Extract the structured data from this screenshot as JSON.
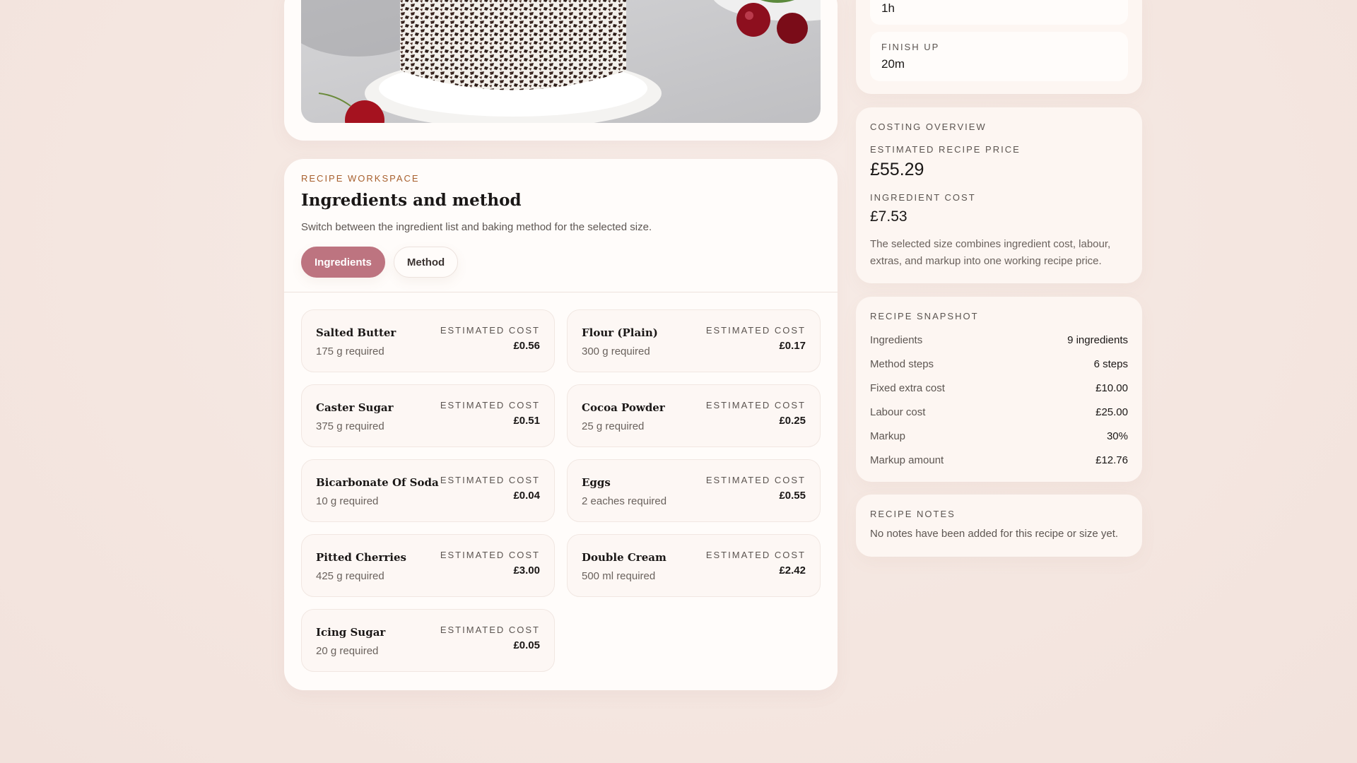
{
  "workspace": {
    "eyebrow": "RECIPE WORKSPACE",
    "title": "Ingredients and method",
    "subtitle": "Switch between the ingredient list and baking method for the selected size.",
    "tabs": [
      {
        "label": "Ingredients",
        "active": true
      },
      {
        "label": "Method",
        "active": false
      }
    ],
    "cost_label": "ESTIMATED COST",
    "ingredients": [
      {
        "name": "Salted Butter",
        "qty": "175 g required",
        "cost": "£0.56"
      },
      {
        "name": "Flour (Plain)",
        "qty": "300 g required",
        "cost": "£0.17"
      },
      {
        "name": "Caster Sugar",
        "qty": "375 g required",
        "cost": "£0.51"
      },
      {
        "name": "Cocoa Powder",
        "qty": "25 g required",
        "cost": "£0.25"
      },
      {
        "name": "Bicarbonate Of Soda",
        "qty": "10 g required",
        "cost": "£0.04"
      },
      {
        "name": "Eggs",
        "qty": "2 eaches required",
        "cost": "£0.55"
      },
      {
        "name": "Pitted Cherries",
        "qty": "425 g required",
        "cost": "£3.00"
      },
      {
        "name": "Double Cream",
        "qty": "500 ml required",
        "cost": "£2.42"
      },
      {
        "name": "Icing Sugar",
        "qty": "20 g required",
        "cost": "£0.05"
      }
    ]
  },
  "timing": {
    "top_value": "1h",
    "finish_label": "FINISH UP",
    "finish_value": "20m"
  },
  "costing": {
    "title": "COSTING OVERVIEW",
    "price_label": "ESTIMATED RECIPE PRICE",
    "price_value": "£55.29",
    "ingredient_label": "INGREDIENT COST",
    "ingredient_value": "£7.53",
    "description": "The selected size combines ingredient cost, labour, extras, and markup into one working recipe price."
  },
  "snapshot": {
    "title": "RECIPE SNAPSHOT",
    "rows": [
      {
        "k": "Ingredients",
        "v": "9 ingredients"
      },
      {
        "k": "Method steps",
        "v": "6 steps"
      },
      {
        "k": "Fixed extra cost",
        "v": "£10.00"
      },
      {
        "k": "Labour cost",
        "v": "£25.00"
      },
      {
        "k": "Markup",
        "v": "30%"
      },
      {
        "k": "Markup amount",
        "v": "£12.76"
      }
    ]
  },
  "notes": {
    "title": "RECIPE NOTES",
    "text": "No notes have been added for this recipe or size yet."
  },
  "colors": {
    "accent": "#bd7480",
    "eyebrow": "#a8602e",
    "background": "#f5e8e2"
  }
}
